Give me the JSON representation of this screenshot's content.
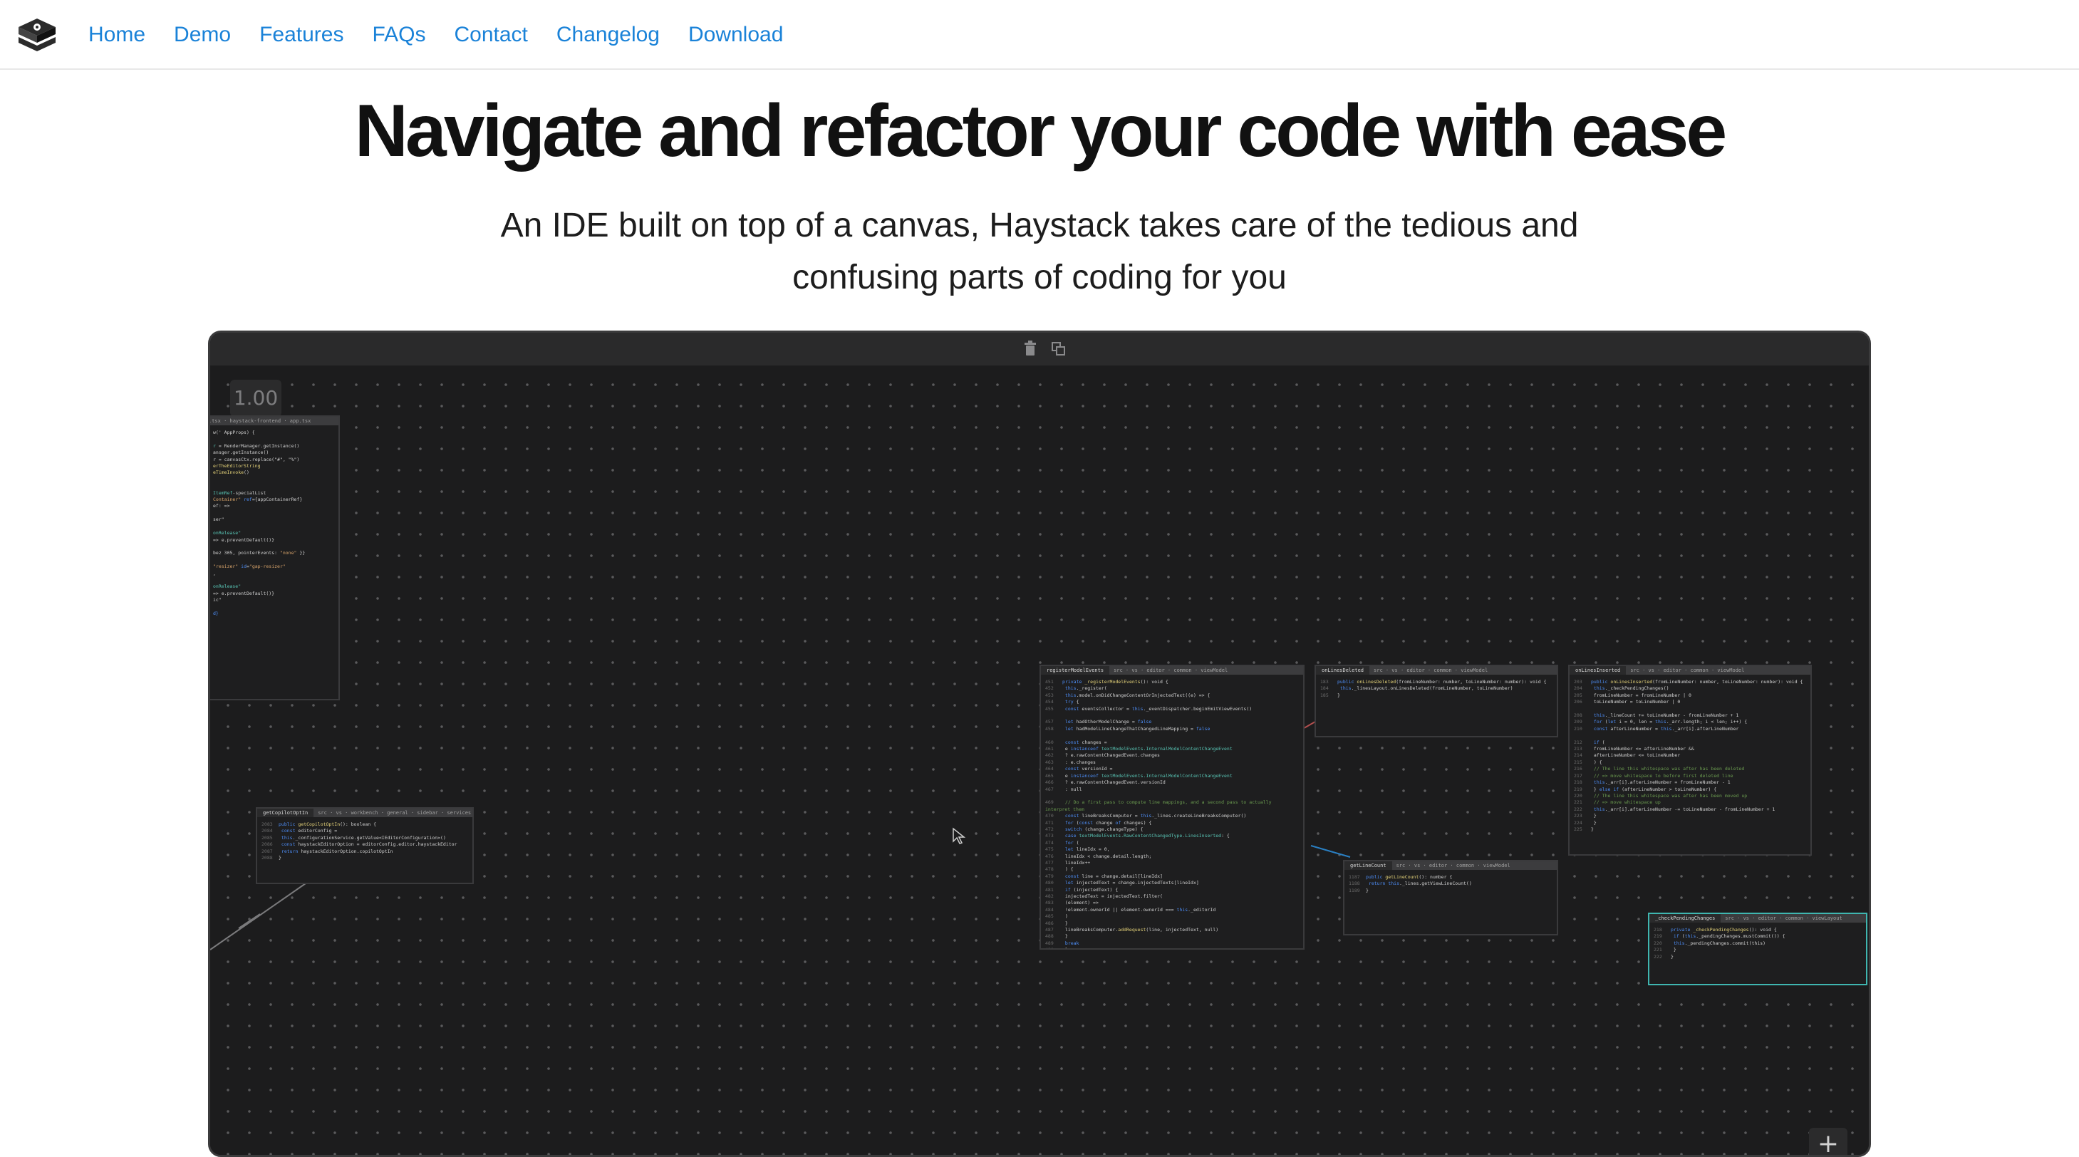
{
  "nav": {
    "logo_icon": "haystack-logo-icon",
    "links": [
      "Home",
      "Demo",
      "Features",
      "FAQs",
      "Contact",
      "Changelog",
      "Download"
    ]
  },
  "hero": {
    "title": "Navigate and refactor your code with ease",
    "subtitle_line1": "An IDE built on top of a canvas, Haystack takes care of the tedious and",
    "subtitle_line2": "confusing parts of coding for you"
  },
  "demo": {
    "zoom": "1.00",
    "toolbar_icons": [
      "trash-icon",
      "copy-icon"
    ],
    "add_button": "+",
    "panels": {
      "p1": {
        "name": "registerModelEvents"
      },
      "p2": {
        "name": "onLinesDeleted"
      },
      "p3": {
        "name": "onLinesInserted"
      },
      "p4": {
        "name": "getCopilotOptIn"
      },
      "p5": {
        "name": "getLineCount"
      },
      "p6": {
        "name": "_checkPendingChanges"
      }
    }
  },
  "colors": {
    "link": "#1a82d8",
    "canvas_bg": "#1c1c1d",
    "panel_border_active": "#3fb6b0"
  }
}
